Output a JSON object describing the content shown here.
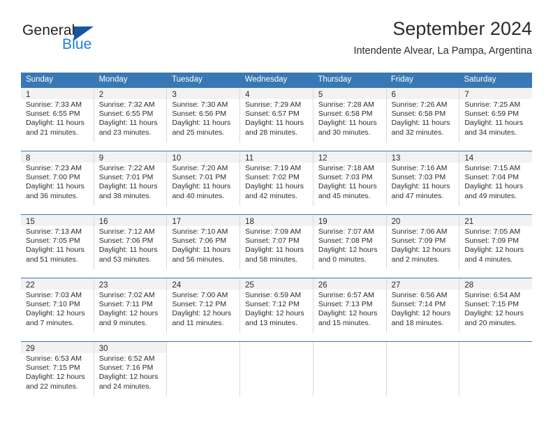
{
  "logo": {
    "word_one": "General",
    "word_two": "Blue",
    "triangle_color": "#15569e",
    "blue_color": "#1f7fd0"
  },
  "header": {
    "month_title": "September 2024",
    "location": "Intendente Alvear, La Pampa, Argentina"
  },
  "theme": {
    "header_blue": "#3878b4",
    "daynum_band": "#f2f2f2",
    "cell_border": "#d8d8d8"
  },
  "weekdays": [
    "Sunday",
    "Monday",
    "Tuesday",
    "Wednesday",
    "Thursday",
    "Friday",
    "Saturday"
  ],
  "weeks": [
    [
      {
        "day": "1",
        "sunrise": "Sunrise: 7:33 AM",
        "sunset": "Sunset: 6:55 PM",
        "daylight1": "Daylight: 11 hours",
        "daylight2": "and 21 minutes."
      },
      {
        "day": "2",
        "sunrise": "Sunrise: 7:32 AM",
        "sunset": "Sunset: 6:55 PM",
        "daylight1": "Daylight: 11 hours",
        "daylight2": "and 23 minutes."
      },
      {
        "day": "3",
        "sunrise": "Sunrise: 7:30 AM",
        "sunset": "Sunset: 6:56 PM",
        "daylight1": "Daylight: 11 hours",
        "daylight2": "and 25 minutes."
      },
      {
        "day": "4",
        "sunrise": "Sunrise: 7:29 AM",
        "sunset": "Sunset: 6:57 PM",
        "daylight1": "Daylight: 11 hours",
        "daylight2": "and 28 minutes."
      },
      {
        "day": "5",
        "sunrise": "Sunrise: 7:28 AM",
        "sunset": "Sunset: 6:58 PM",
        "daylight1": "Daylight: 11 hours",
        "daylight2": "and 30 minutes."
      },
      {
        "day": "6",
        "sunrise": "Sunrise: 7:26 AM",
        "sunset": "Sunset: 6:58 PM",
        "daylight1": "Daylight: 11 hours",
        "daylight2": "and 32 minutes."
      },
      {
        "day": "7",
        "sunrise": "Sunrise: 7:25 AM",
        "sunset": "Sunset: 6:59 PM",
        "daylight1": "Daylight: 11 hours",
        "daylight2": "and 34 minutes."
      }
    ],
    [
      {
        "day": "8",
        "sunrise": "Sunrise: 7:23 AM",
        "sunset": "Sunset: 7:00 PM",
        "daylight1": "Daylight: 11 hours",
        "daylight2": "and 36 minutes."
      },
      {
        "day": "9",
        "sunrise": "Sunrise: 7:22 AM",
        "sunset": "Sunset: 7:01 PM",
        "daylight1": "Daylight: 11 hours",
        "daylight2": "and 38 minutes."
      },
      {
        "day": "10",
        "sunrise": "Sunrise: 7:20 AM",
        "sunset": "Sunset: 7:01 PM",
        "daylight1": "Daylight: 11 hours",
        "daylight2": "and 40 minutes."
      },
      {
        "day": "11",
        "sunrise": "Sunrise: 7:19 AM",
        "sunset": "Sunset: 7:02 PM",
        "daylight1": "Daylight: 11 hours",
        "daylight2": "and 42 minutes."
      },
      {
        "day": "12",
        "sunrise": "Sunrise: 7:18 AM",
        "sunset": "Sunset: 7:03 PM",
        "daylight1": "Daylight: 11 hours",
        "daylight2": "and 45 minutes."
      },
      {
        "day": "13",
        "sunrise": "Sunrise: 7:16 AM",
        "sunset": "Sunset: 7:03 PM",
        "daylight1": "Daylight: 11 hours",
        "daylight2": "and 47 minutes."
      },
      {
        "day": "14",
        "sunrise": "Sunrise: 7:15 AM",
        "sunset": "Sunset: 7:04 PM",
        "daylight1": "Daylight: 11 hours",
        "daylight2": "and 49 minutes."
      }
    ],
    [
      {
        "day": "15",
        "sunrise": "Sunrise: 7:13 AM",
        "sunset": "Sunset: 7:05 PM",
        "daylight1": "Daylight: 11 hours",
        "daylight2": "and 51 minutes."
      },
      {
        "day": "16",
        "sunrise": "Sunrise: 7:12 AM",
        "sunset": "Sunset: 7:06 PM",
        "daylight1": "Daylight: 11 hours",
        "daylight2": "and 53 minutes."
      },
      {
        "day": "17",
        "sunrise": "Sunrise: 7:10 AM",
        "sunset": "Sunset: 7:06 PM",
        "daylight1": "Daylight: 11 hours",
        "daylight2": "and 56 minutes."
      },
      {
        "day": "18",
        "sunrise": "Sunrise: 7:09 AM",
        "sunset": "Sunset: 7:07 PM",
        "daylight1": "Daylight: 11 hours",
        "daylight2": "and 58 minutes."
      },
      {
        "day": "19",
        "sunrise": "Sunrise: 7:07 AM",
        "sunset": "Sunset: 7:08 PM",
        "daylight1": "Daylight: 12 hours",
        "daylight2": "and 0 minutes."
      },
      {
        "day": "20",
        "sunrise": "Sunrise: 7:06 AM",
        "sunset": "Sunset: 7:09 PM",
        "daylight1": "Daylight: 12 hours",
        "daylight2": "and 2 minutes."
      },
      {
        "day": "21",
        "sunrise": "Sunrise: 7:05 AM",
        "sunset": "Sunset: 7:09 PM",
        "daylight1": "Daylight: 12 hours",
        "daylight2": "and 4 minutes."
      }
    ],
    [
      {
        "day": "22",
        "sunrise": "Sunrise: 7:03 AM",
        "sunset": "Sunset: 7:10 PM",
        "daylight1": "Daylight: 12 hours",
        "daylight2": "and 7 minutes."
      },
      {
        "day": "23",
        "sunrise": "Sunrise: 7:02 AM",
        "sunset": "Sunset: 7:11 PM",
        "daylight1": "Daylight: 12 hours",
        "daylight2": "and 9 minutes."
      },
      {
        "day": "24",
        "sunrise": "Sunrise: 7:00 AM",
        "sunset": "Sunset: 7:12 PM",
        "daylight1": "Daylight: 12 hours",
        "daylight2": "and 11 minutes."
      },
      {
        "day": "25",
        "sunrise": "Sunrise: 6:59 AM",
        "sunset": "Sunset: 7:12 PM",
        "daylight1": "Daylight: 12 hours",
        "daylight2": "and 13 minutes."
      },
      {
        "day": "26",
        "sunrise": "Sunrise: 6:57 AM",
        "sunset": "Sunset: 7:13 PM",
        "daylight1": "Daylight: 12 hours",
        "daylight2": "and 15 minutes."
      },
      {
        "day": "27",
        "sunrise": "Sunrise: 6:56 AM",
        "sunset": "Sunset: 7:14 PM",
        "daylight1": "Daylight: 12 hours",
        "daylight2": "and 18 minutes."
      },
      {
        "day": "28",
        "sunrise": "Sunrise: 6:54 AM",
        "sunset": "Sunset: 7:15 PM",
        "daylight1": "Daylight: 12 hours",
        "daylight2": "and 20 minutes."
      }
    ],
    [
      {
        "day": "29",
        "sunrise": "Sunrise: 6:53 AM",
        "sunset": "Sunset: 7:15 PM",
        "daylight1": "Daylight: 12 hours",
        "daylight2": "and 22 minutes."
      },
      {
        "day": "30",
        "sunrise": "Sunrise: 6:52 AM",
        "sunset": "Sunset: 7:16 PM",
        "daylight1": "Daylight: 12 hours",
        "daylight2": "and 24 minutes."
      },
      {
        "day": "",
        "sunrise": "",
        "sunset": "",
        "daylight1": "",
        "daylight2": ""
      },
      {
        "day": "",
        "sunrise": "",
        "sunset": "",
        "daylight1": "",
        "daylight2": ""
      },
      {
        "day": "",
        "sunrise": "",
        "sunset": "",
        "daylight1": "",
        "daylight2": ""
      },
      {
        "day": "",
        "sunrise": "",
        "sunset": "",
        "daylight1": "",
        "daylight2": ""
      },
      {
        "day": "",
        "sunrise": "",
        "sunset": "",
        "daylight1": "",
        "daylight2": ""
      }
    ]
  ]
}
